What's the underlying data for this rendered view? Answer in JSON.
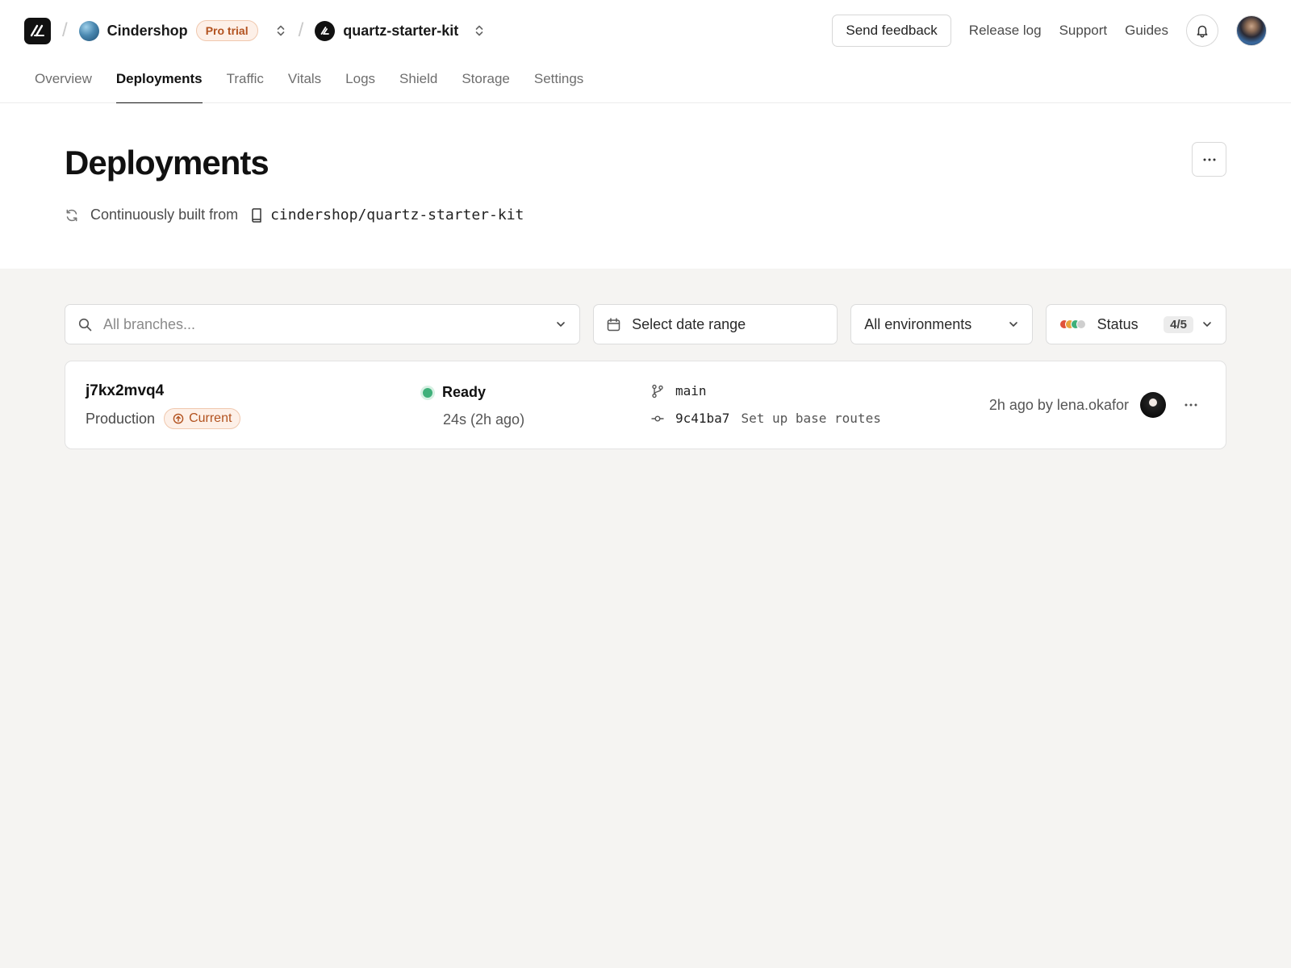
{
  "header": {
    "team": {
      "name": "Cindershop",
      "badge": "Pro trial"
    },
    "project": {
      "name": "quartz-starter-kit"
    },
    "feedback_label": "Send feedback",
    "links": [
      "Release log",
      "Support",
      "Guides"
    ]
  },
  "tabs": [
    {
      "label": "Overview",
      "active": false
    },
    {
      "label": "Deployments",
      "active": true
    },
    {
      "label": "Traffic",
      "active": false
    },
    {
      "label": "Vitals",
      "active": false
    },
    {
      "label": "Logs",
      "active": false
    },
    {
      "label": "Shield",
      "active": false
    },
    {
      "label": "Storage",
      "active": false
    },
    {
      "label": "Settings",
      "active": false
    }
  ],
  "page": {
    "title": "Deployments",
    "built_from_label": "Continuously built from",
    "repo": "cindershop/quartz-starter-kit"
  },
  "filters": {
    "branch_placeholder": "All branches...",
    "date_label": "Select date range",
    "environment_value": "All environments",
    "status_label": "Status",
    "status_count": "4/5",
    "status_colors": [
      "#e0523a",
      "#e8a23c",
      "#3fb07a",
      "#cfcfcf"
    ]
  },
  "deployments": [
    {
      "id": "j7kx2mvq4",
      "environment": "Production",
      "badge": "Current",
      "status": "Ready",
      "status_color": "#3fb07a",
      "duration": "24s (2h ago)",
      "branch": "main",
      "commit_hash": "9c41ba7",
      "commit_message": "Set up base routes",
      "meta": "2h ago by lena.okafor"
    }
  ],
  "colors": {
    "accent_badge": "#b2521f",
    "background": "#f5f4f2"
  }
}
